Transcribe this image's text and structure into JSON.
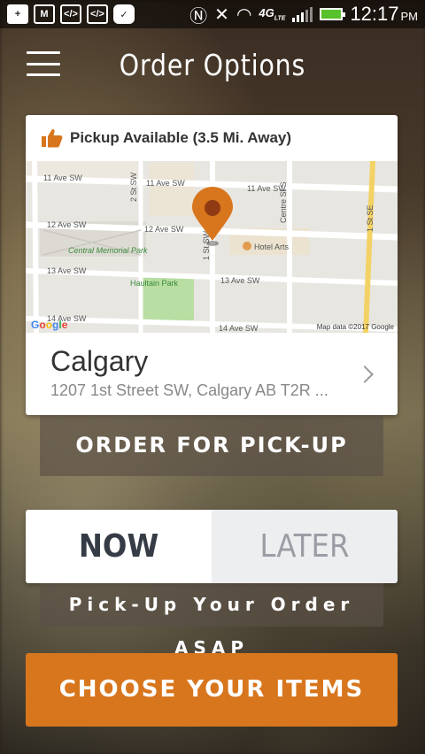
{
  "status_bar": {
    "time": "12:17",
    "ampm": "PM",
    "network": "4G",
    "network_sub": "LTE",
    "battery_color": "#57c22b"
  },
  "header": {
    "title": "Order Options",
    "menu_icon": "hamburger-menu-icon"
  },
  "pickup_card": {
    "availability_text": "Pickup Available (3.5 Mi. Away)",
    "thumb_icon": "thumbs-up-icon",
    "thumb_color": "#d8761d",
    "map": {
      "streets": [
        "11 Ave SW",
        "11 Ave SW",
        "11 Ave SW",
        "12 Ave SW",
        "12 Ave SW",
        "13 Ave SW",
        "13 Ave SW",
        "14 Ave SW",
        "14 Ave SW",
        "2 St SW",
        "1 St SW",
        "Centre St S",
        "1 St SE"
      ],
      "places": [
        "Central Memorial Park",
        "Haultain Park",
        "Hotel Arts"
      ],
      "credit": "Map data ©2017 Google",
      "logo": "Google",
      "pin_color": "#d8761d"
    },
    "location": {
      "city": "Calgary",
      "address": "1207 1st Street SW, Calgary AB T2R ..."
    }
  },
  "order_pickup_label": "ORDER FOR PICK-UP",
  "timing_toggle": {
    "now_label": "NOW",
    "later_label": "LATER",
    "selected": "NOW"
  },
  "asap_text": "Pick-Up Your Order ASAP",
  "cta_label": "CHOOSE YOUR ITEMS",
  "colors": {
    "accent": "#d8761d",
    "now_text": "#353c45",
    "later_text": "#9a9ea4"
  }
}
